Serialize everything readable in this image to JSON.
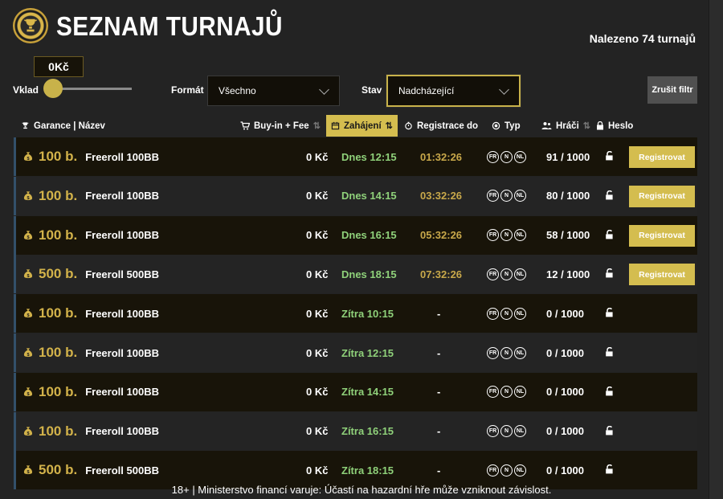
{
  "header": {
    "title": "SEZNAM TURNAJŮ",
    "found": "Nalezeno 74 turnajů"
  },
  "filters": {
    "vklad_label": "Vklad",
    "vklad_value": "0Kč",
    "vklad_level_fraction": 0,
    "format_label": "Formát",
    "format_value": "Všechno",
    "stav_label": "Stav",
    "stav_value": "Nadcházející",
    "reset_label": "Zrušit filtr"
  },
  "columns": {
    "guarantee": "Garance | Název",
    "buyin": "Buy-in + Fee",
    "start": "Zahájení",
    "registration": "Registrace do",
    "type": "Typ",
    "players": "Hráči",
    "password": "Heslo"
  },
  "type_badges": [
    "FR",
    "N",
    "NL"
  ],
  "register_label": "Registrovat",
  "rows": [
    {
      "amount": "100 b.",
      "name": "Freeroll 100BB",
      "buyin": "0 Kč",
      "start": "Dnes 12:15",
      "reg": "01:32:26",
      "players": "91 / 1000",
      "register": true
    },
    {
      "amount": "100 b.",
      "name": "Freeroll 100BB",
      "buyin": "0 Kč",
      "start": "Dnes 14:15",
      "reg": "03:32:26",
      "players": "80 / 1000",
      "register": true
    },
    {
      "amount": "100 b.",
      "name": "Freeroll 100BB",
      "buyin": "0 Kč",
      "start": "Dnes 16:15",
      "reg": "05:32:26",
      "players": "58 / 1000",
      "register": true
    },
    {
      "amount": "500 b.",
      "name": "Freeroll 500BB",
      "buyin": "0 Kč",
      "start": "Dnes 18:15",
      "reg": "07:32:26",
      "players": "12 / 1000",
      "register": true
    },
    {
      "amount": "100 b.",
      "name": "Freeroll 100BB",
      "buyin": "0 Kč",
      "start": "Zítra 10:15",
      "reg": "-",
      "players": "0 / 1000",
      "register": false
    },
    {
      "amount": "100 b.",
      "name": "Freeroll 100BB",
      "buyin": "0 Kč",
      "start": "Zítra 12:15",
      "reg": "-",
      "players": "0 / 1000",
      "register": false
    },
    {
      "amount": "100 b.",
      "name": "Freeroll 100BB",
      "buyin": "0 Kč",
      "start": "Zítra 14:15",
      "reg": "-",
      "players": "0 / 1000",
      "register": false
    },
    {
      "amount": "100 b.",
      "name": "Freeroll 100BB",
      "buyin": "0 Kč",
      "start": "Zítra 16:15",
      "reg": "-",
      "players": "0 / 1000",
      "register": false
    },
    {
      "amount": "500 b.",
      "name": "Freeroll 500BB",
      "buyin": "0 Kč",
      "start": "Zítra 18:15",
      "reg": "-",
      "players": "0 / 1000",
      "register": false
    }
  ],
  "footer": "18+ | Ministerstvo financí varuje: Účastí na hazardní hře může vzniknout závislost."
}
